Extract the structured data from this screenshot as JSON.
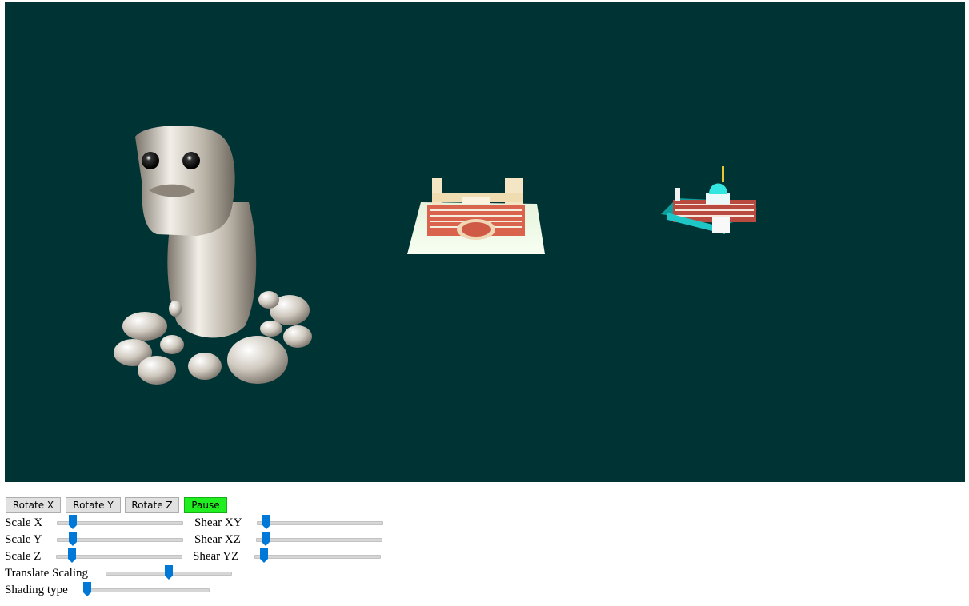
{
  "viewport": {
    "background": "#003333"
  },
  "buttons": {
    "rotate_x": "Rotate X",
    "rotate_y": "Rotate Y",
    "rotate_z": "Rotate Z",
    "pause": "Pause"
  },
  "sliders": {
    "scale_x": {
      "label": "Scale X",
      "value": 0.1
    },
    "scale_y": {
      "label": "Scale Y",
      "value": 0.1
    },
    "scale_z": {
      "label": "Scale Z",
      "value": 0.1
    },
    "shear_xy": {
      "label": "Shear XY",
      "value": 0.05
    },
    "shear_xz": {
      "label": "Shear XZ",
      "value": 0.05
    },
    "shear_yz": {
      "label": "Shear YZ",
      "value": 0.05
    },
    "translate_scaling": {
      "label": "Translate Scaling",
      "value": 0.5
    },
    "shading_type": {
      "label": "Shading type",
      "value": 0.0
    }
  },
  "accent_color": "#0078d7"
}
